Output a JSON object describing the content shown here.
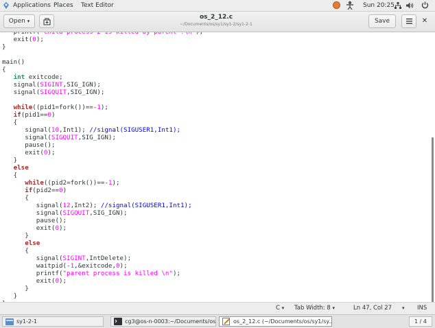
{
  "top_panel": {
    "applications": "Applications",
    "places": "Places",
    "text_editor": "Text Editor",
    "clock": "Sun 20:25"
  },
  "header": {
    "open_label": "Open",
    "title": "os_2_12.c",
    "subtitle": "~/Documents/os/sy1/sy1-2/sy1-2-1",
    "save_label": "Save"
  },
  "code_lines": [
    [
      [
        "plain",
        "   printf("
      ],
      [
        "str",
        "\"child process 2 is killed by parent !\\n\""
      ],
      [
        "plain",
        ");"
      ]
    ],
    [
      [
        "plain",
        "   exit("
      ],
      [
        "num",
        "0"
      ],
      [
        "plain",
        ");"
      ]
    ],
    [
      [
        "plain",
        "}"
      ]
    ],
    [
      [
        "plain",
        ""
      ]
    ],
    [
      [
        "plain",
        "main()"
      ]
    ],
    [
      [
        "plain",
        "{"
      ]
    ],
    [
      [
        "plain",
        "   "
      ],
      [
        "type",
        "int"
      ],
      [
        "plain",
        " exitcode;"
      ]
    ],
    [
      [
        "plain",
        "   signal("
      ],
      [
        "const",
        "SIGINT"
      ],
      [
        "plain",
        ",SIG_IGN);"
      ]
    ],
    [
      [
        "plain",
        "   signal("
      ],
      [
        "const",
        "SIGQUIT"
      ],
      [
        "plain",
        ",SIG_IGN);"
      ]
    ],
    [
      [
        "plain",
        ""
      ]
    ],
    [
      [
        "plain",
        "   "
      ],
      [
        "kw",
        "while"
      ],
      [
        "plain",
        "((pid1=fork())==-"
      ],
      [
        "num",
        "1"
      ],
      [
        "plain",
        ");"
      ]
    ],
    [
      [
        "plain",
        "   "
      ],
      [
        "kw",
        "if"
      ],
      [
        "plain",
        "(pid1=="
      ],
      [
        "num",
        "0"
      ],
      [
        "plain",
        ")"
      ]
    ],
    [
      [
        "plain",
        "   {"
      ]
    ],
    [
      [
        "plain",
        "      signal("
      ],
      [
        "num",
        "10"
      ],
      [
        "plain",
        ",Int1); "
      ],
      [
        "cmt",
        "//signal(SIGUSER1,Int1);"
      ]
    ],
    [
      [
        "plain",
        "      signal("
      ],
      [
        "const",
        "SIGQUIT"
      ],
      [
        "plain",
        ",SIG_IGN);"
      ]
    ],
    [
      [
        "plain",
        "      pause();"
      ]
    ],
    [
      [
        "plain",
        "      exit("
      ],
      [
        "num",
        "0"
      ],
      [
        "plain",
        ");"
      ]
    ],
    [
      [
        "plain",
        "   }"
      ]
    ],
    [
      [
        "plain",
        "   "
      ],
      [
        "kw",
        "else"
      ]
    ],
    [
      [
        "plain",
        "   {"
      ]
    ],
    [
      [
        "plain",
        "      "
      ],
      [
        "kw",
        "while"
      ],
      [
        "plain",
        "((pid2=fork())==-"
      ],
      [
        "num",
        "1"
      ],
      [
        "plain",
        ");"
      ]
    ],
    [
      [
        "plain",
        "      "
      ],
      [
        "kw",
        "if"
      ],
      [
        "plain",
        "(pid2=="
      ],
      [
        "num",
        "0"
      ],
      [
        "plain",
        ")"
      ]
    ],
    [
      [
        "plain",
        "      {"
      ]
    ],
    [
      [
        "plain",
        "         signal("
      ],
      [
        "num",
        "12"
      ],
      [
        "plain",
        ",Int2); "
      ],
      [
        "cmt",
        "//signal(SIGUSER1,Int1);"
      ]
    ],
    [
      [
        "plain",
        "         signal("
      ],
      [
        "const",
        "SIGQUIT"
      ],
      [
        "plain",
        ",SIG_IGN);"
      ]
    ],
    [
      [
        "plain",
        "         pause();"
      ]
    ],
    [
      [
        "plain",
        "         exit("
      ],
      [
        "num",
        "0"
      ],
      [
        "plain",
        ");"
      ]
    ],
    [
      [
        "plain",
        "      }"
      ]
    ],
    [
      [
        "plain",
        "      "
      ],
      [
        "kw",
        "else"
      ]
    ],
    [
      [
        "plain",
        "      {"
      ]
    ],
    [
      [
        "plain",
        "         signal("
      ],
      [
        "const",
        "SIGINT"
      ],
      [
        "plain",
        ",IntDelete);"
      ]
    ],
    [
      [
        "plain",
        "         waitpid(-"
      ],
      [
        "num",
        "1"
      ],
      [
        "plain",
        ",&exitcode,"
      ],
      [
        "num",
        "0"
      ],
      [
        "plain",
        ");"
      ]
    ],
    [
      [
        "plain",
        "         printf("
      ],
      [
        "str",
        "\"parent process is killed \\n\""
      ],
      [
        "plain",
        ");"
      ]
    ],
    [
      [
        "plain",
        "         exit("
      ],
      [
        "num",
        "0"
      ],
      [
        "plain",
        ");"
      ]
    ],
    [
      [
        "plain",
        "      }"
      ]
    ],
    [
      [
        "plain",
        "   }"
      ]
    ],
    [
      [
        "plain",
        "}"
      ]
    ]
  ],
  "status_bar": {
    "language": "C",
    "tab_width": "Tab Width: 8",
    "position": "Ln 47, Col 27",
    "mode": "INS"
  },
  "taskbar": {
    "items": [
      {
        "label": "sy1-2-1"
      },
      {
        "label": "cg3@os-n-0003:~/Documents/os/s..."
      },
      {
        "label": "os_2_12.c (~/Documents/os/sy1/sy..."
      }
    ],
    "pager": "1 / 4"
  },
  "colors": {
    "keyword": "#a52a2a",
    "type": "#2e8b57",
    "constant": "#ff00ff",
    "comment": "#0000ff",
    "background": "#ffffff"
  }
}
